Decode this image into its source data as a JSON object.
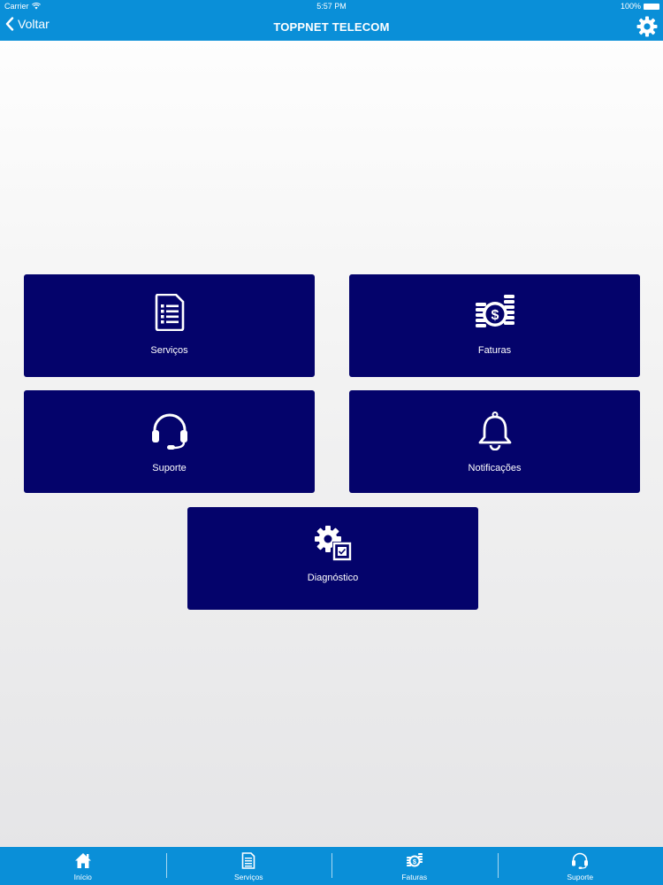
{
  "status_bar": {
    "carrier": "Carrier",
    "time": "5:57 PM",
    "battery": "100%"
  },
  "header": {
    "back_label": "Voltar",
    "title": "TOPPNET TELECOM"
  },
  "tiles": [
    {
      "label": "Serviços",
      "icon": "document-list-icon"
    },
    {
      "label": "Faturas",
      "icon": "coins-dollar-icon"
    },
    {
      "label": "Suporte",
      "icon": "headset-icon"
    },
    {
      "label": "Notificações",
      "icon": "bell-icon"
    },
    {
      "label": "Diagnóstico",
      "icon": "gear-check-icon"
    }
  ],
  "tabbar": [
    {
      "label": "Início",
      "icon": "home-icon"
    },
    {
      "label": "Serviços",
      "icon": "document-list-icon"
    },
    {
      "label": "Faturas",
      "icon": "coins-dollar-icon"
    },
    {
      "label": "Suporte",
      "icon": "headset-icon"
    }
  ],
  "colors": {
    "bar": "#0a8fd8",
    "tile": "#04036b",
    "text": "#ffffff"
  }
}
